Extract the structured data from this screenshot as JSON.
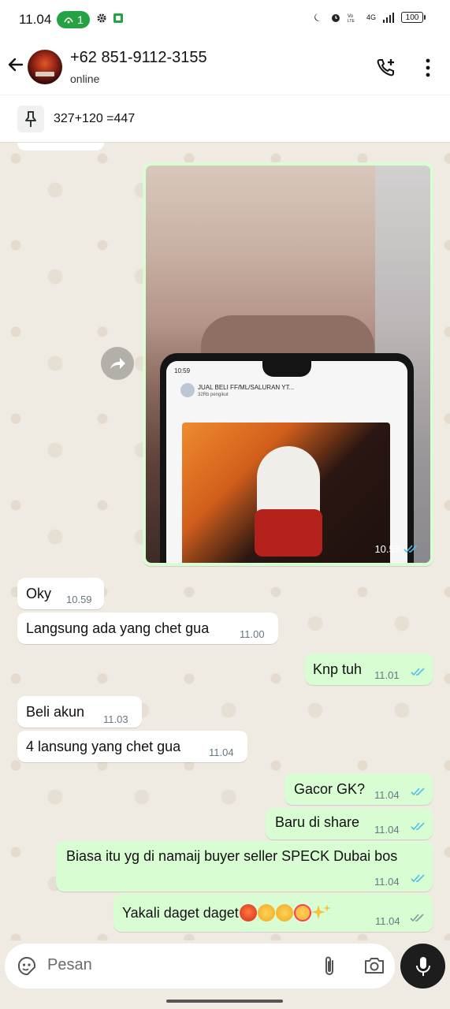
{
  "status_bar": {
    "time": "11.04",
    "badge_count": "1",
    "battery": "100",
    "network": "4G"
  },
  "header": {
    "contact_name": "+62 851-9112-3155",
    "contact_status": "online"
  },
  "pinned": {
    "text": "327+120 =447"
  },
  "image_message": {
    "time": "10.59",
    "screen_time": "10:59",
    "channel_name": "JUAL BELI FF/ML/SALURAN YT...",
    "channel_followers": "32Rb pengikut"
  },
  "messages": [
    {
      "direction": "in",
      "text": "Oky",
      "time": "10.59"
    },
    {
      "direction": "in",
      "text": "Langsung ada yang chet gua",
      "time": "11.00"
    },
    {
      "direction": "out",
      "text": "Knp tuh",
      "time": "11.01",
      "status": "read"
    },
    {
      "direction": "in",
      "text": "Beli akun",
      "time": "11.03"
    },
    {
      "direction": "in",
      "text": "4 lansung yang chet gua",
      "time": "11.04"
    },
    {
      "direction": "out",
      "text": "Gacor GK?",
      "time": "11.04",
      "status": "read"
    },
    {
      "direction": "out",
      "text": "Baru di share",
      "time": "11.04",
      "status": "read"
    },
    {
      "direction": "out",
      "text": "Biasa itu yg di namaij buyer seller SPECK Dubai bos",
      "time": "11.04",
      "status": "read"
    },
    {
      "direction": "out",
      "text": "Yakali daget daget",
      "time": "11.04",
      "status": "delivered"
    }
  ],
  "input": {
    "placeholder": "Pesan"
  },
  "colors": {
    "incoming": "#ffffff",
    "outgoing": "#d9fdd3",
    "read_tick": "#53bdeb",
    "delivered_tick": "#8696a0",
    "chat_bg": "#efeae2"
  }
}
